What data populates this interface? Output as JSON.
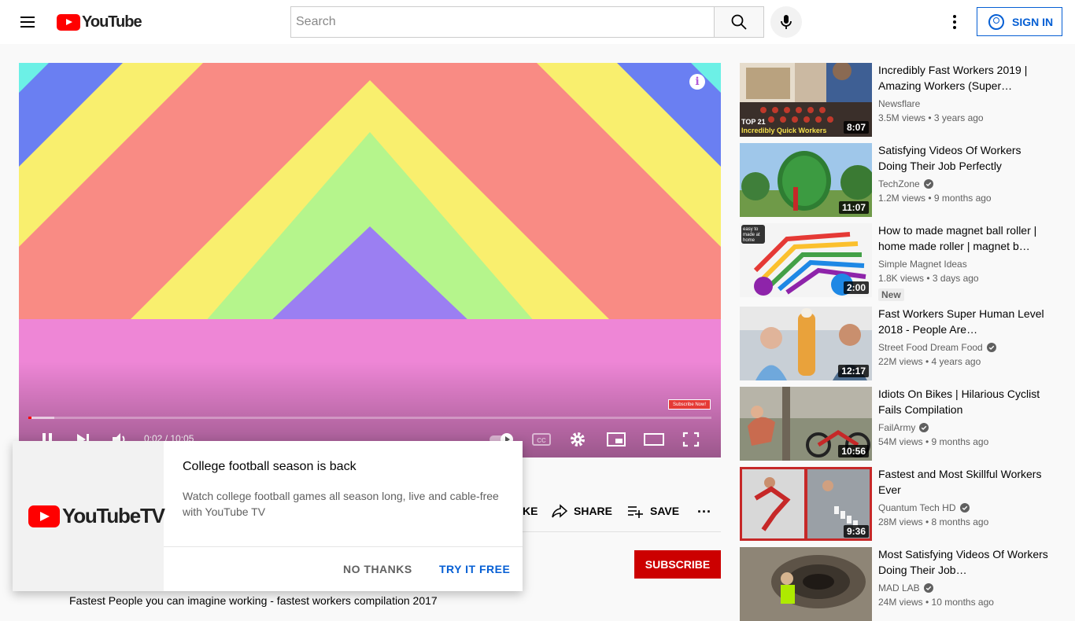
{
  "header": {
    "logo_text": "YouTube",
    "search_placeholder": "Search",
    "signin_label": "SIGN IN"
  },
  "player": {
    "time": "0:02 / 10:05",
    "subscribe_now_badge": "Subscribe Now!",
    "info_glyph": "i",
    "progress_played": 0.005,
    "progress_loaded": 0.038
  },
  "actions": {
    "like_partial": "KE",
    "share": "SHARE",
    "save": "SAVE",
    "more": "..."
  },
  "channel_row": {
    "subscribe": "SUBSCRIBE"
  },
  "description_partial": "Fastest People you can imagine working - fastest workers compilation 2017",
  "promo": {
    "logo_text": "YouTubeTV",
    "title": "College football season is back",
    "body": "Watch college football games all season long, live and cable-free with YouTube TV",
    "no_thanks": "NO THANKS",
    "try_free": "TRY IT FREE"
  },
  "recommendations": [
    {
      "title": "Incredibly Fast Workers 2019 | Amazing Workers (Super…",
      "channel": "Newsflare",
      "verified": false,
      "meta": "3.5M views • 3 years ago",
      "duration": "8:07",
      "thumb_text": "TOP 21 Incredibly Quick Workers"
    },
    {
      "title": "Satisfying Videos Of Workers Doing Their Job Perfectly",
      "channel": "TechZone",
      "verified": true,
      "meta": "1.2M views • 9 months ago",
      "duration": "11:07"
    },
    {
      "title": "How to made magnet ball roller | home made roller | magnet b…",
      "channel": "Simple Magnet Ideas",
      "verified": false,
      "meta": "1.8K views • 3 days ago",
      "duration": "2:00",
      "badge": "New",
      "thumb_text": "easy to made at home"
    },
    {
      "title": "Fast Workers Super Human Level 2018 - People Are…",
      "channel": "Street Food Dream Food",
      "verified": true,
      "meta": "22M views • 4 years ago",
      "duration": "12:17"
    },
    {
      "title": "Idiots On Bikes | Hilarious Cyclist Fails Compilation",
      "channel": "FailArmy",
      "verified": true,
      "meta": "54M views • 9 months ago",
      "duration": "10:56"
    },
    {
      "title": "Fastest and Most Skillful Workers Ever",
      "channel": "Quantum Tech HD",
      "verified": true,
      "meta": "28M views • 8 months ago",
      "duration": "9:36"
    },
    {
      "title": "Most Satisfying Videos Of Workers Doing Their Job…",
      "channel": "MAD LAB",
      "verified": true,
      "meta": "24M views • 10 months ago",
      "duration": ""
    }
  ],
  "colors": {
    "brand_red": "#ff0000",
    "link_blue": "#065fd4",
    "subscribe_red": "#cc0000"
  }
}
